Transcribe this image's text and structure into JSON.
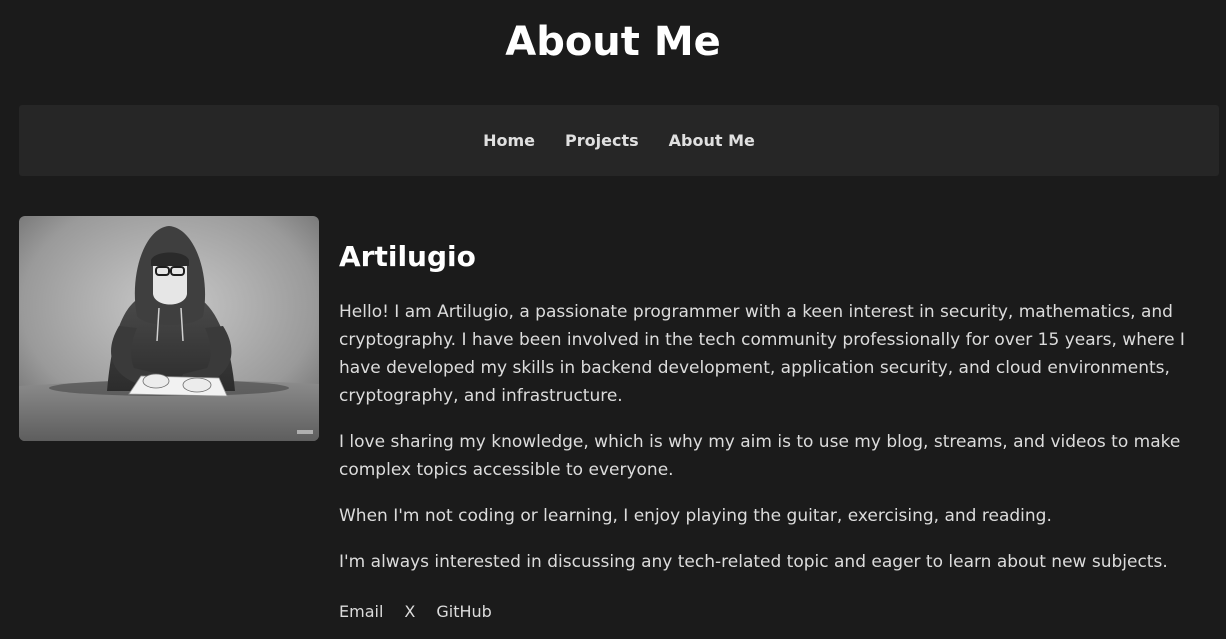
{
  "page": {
    "title": "About Me"
  },
  "nav": {
    "items": [
      {
        "label": "Home"
      },
      {
        "label": "Projects"
      },
      {
        "label": "About Me"
      }
    ]
  },
  "profile": {
    "image_description": "hooded-programmer-illustration",
    "name": "Artilugio",
    "paragraphs": [
      "Hello! I am Artilugio, a passionate programmer with a keen interest in security, mathematics, and cryptography. I have been involved in the tech community professionally for over 15 years, where I have developed my skills in backend development, application security, and cloud environments, cryptography, and infrastructure.",
      "I love sharing my knowledge, which is why my aim is to use my blog, streams, and videos to make complex topics accessible to everyone.",
      "When I'm not coding or learning, I enjoy playing the guitar, exercising, and reading.",
      "I'm always interested in discussing any tech-related topic and eager to learn about new subjects."
    ]
  },
  "social": {
    "links": [
      {
        "label": "Email"
      },
      {
        "label": "X"
      },
      {
        "label": "GitHub"
      }
    ]
  },
  "colors": {
    "background": "#1b1b1b",
    "navbar": "#262626",
    "heading": "#ffffff",
    "text": "#dcdcdc"
  }
}
